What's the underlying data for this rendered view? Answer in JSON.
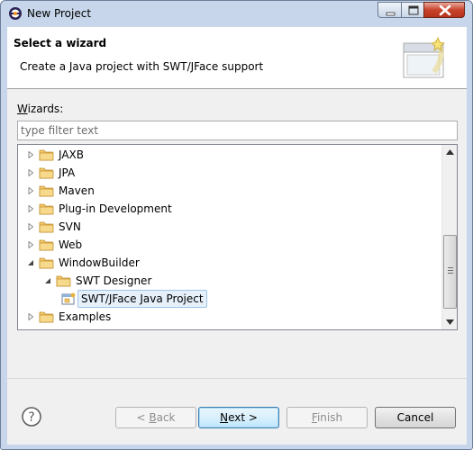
{
  "window": {
    "title": "New Project",
    "app_icon": "eclipse-icon",
    "controls": [
      "minimize-icon",
      "maximize-icon",
      "close-icon"
    ]
  },
  "header": {
    "title": "Select a wizard",
    "description": "Create a Java project with SWT/JFace support",
    "banner_icon": "wizard-banner-icon"
  },
  "wizards_label": "Wizards:",
  "filter": {
    "placeholder": "type filter text",
    "value": ""
  },
  "tree": {
    "items": [
      {
        "label": "JAXB",
        "expanded": false
      },
      {
        "label": "JPA",
        "expanded": false
      },
      {
        "label": "Maven",
        "expanded": false
      },
      {
        "label": "Plug-in Development",
        "expanded": false
      },
      {
        "label": "SVN",
        "expanded": false
      },
      {
        "label": "Web",
        "expanded": false
      },
      {
        "label": "WindowBuilder",
        "expanded": true
      },
      {
        "label": "SWT Designer",
        "expanded": true
      },
      {
        "label": "SWT/JFace Java Project",
        "selected": true
      },
      {
        "label": "Examples",
        "expanded": false
      }
    ]
  },
  "buttons": {
    "back": {
      "pre": "< ",
      "mnemonic": "B",
      "post": "ack"
    },
    "next": {
      "pre": "",
      "mnemonic": "N",
      "post": "ext >"
    },
    "finish": {
      "pre": "",
      "mnemonic": "F",
      "post": "inish"
    },
    "cancel": "Cancel"
  },
  "colors": {
    "frame": "#c7d6ea",
    "selection_bg": "#e6f0fa",
    "folder": "#e8b84a",
    "default_button_border": "#3c7fb1"
  }
}
